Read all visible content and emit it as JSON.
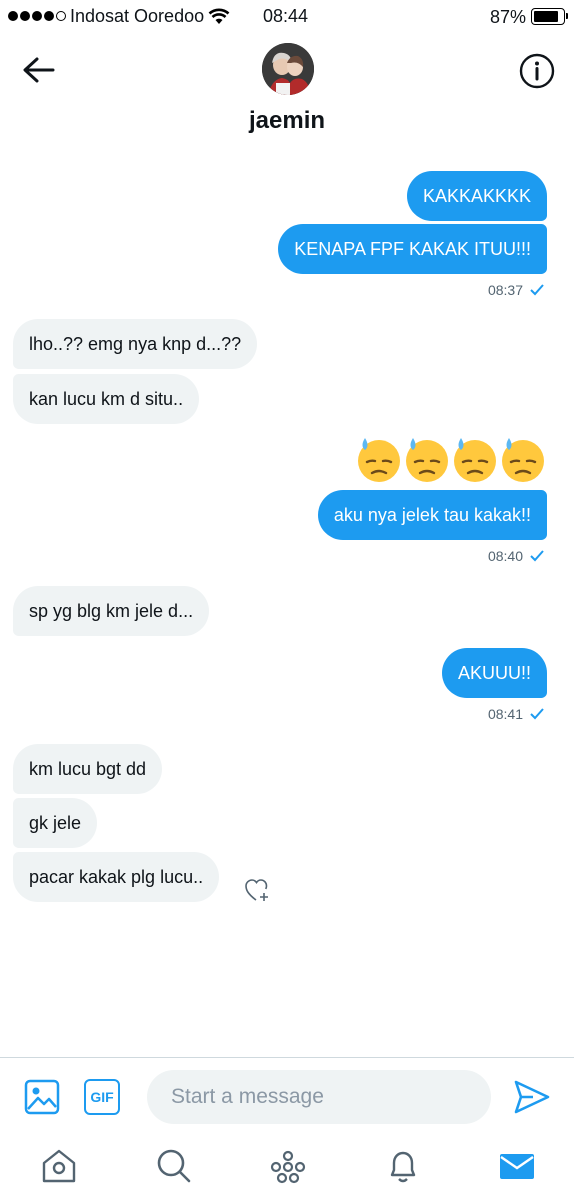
{
  "status_bar": {
    "carrier": "Indosat Ooredoo",
    "time": "08:44",
    "battery_percent": "87%",
    "battery_level": 0.87,
    "signal_bars_filled": 4,
    "signal_bars_total": 5
  },
  "header": {
    "contact_name": "jaemin",
    "back_icon": "arrow-left-icon",
    "info_icon": "info-icon"
  },
  "messages": [
    {
      "direction": "out",
      "text": "KAKKAKKKK"
    },
    {
      "direction": "out",
      "text": "KENAPA FPF KAKAK ITUU!!!"
    },
    {
      "direction": "out-time",
      "text": "08:37"
    },
    {
      "direction": "in",
      "text": "lho..?? emg nya knp d...??"
    },
    {
      "direction": "in",
      "text": "kan lucu km d situ.."
    },
    {
      "direction": "out-emoji",
      "emoji": "downcast-face-with-sweat",
      "count": 4
    },
    {
      "direction": "out",
      "text": "aku nya jelek tau kakak!!"
    },
    {
      "direction": "out-time",
      "text": "08:40"
    },
    {
      "direction": "in",
      "text": "sp yg blg km jele d..."
    },
    {
      "direction": "out",
      "text": "AKUUU!!"
    },
    {
      "direction": "out-time",
      "text": "08:41"
    },
    {
      "direction": "in",
      "text": "km lucu bgt dd"
    },
    {
      "direction": "in",
      "text": "gk jele"
    },
    {
      "direction": "in",
      "text": "pacar kakak plg lucu.."
    }
  ],
  "composer": {
    "placeholder": "Start a message",
    "gif_label": "GIF",
    "media_icon": "image-icon",
    "send_icon": "send-icon"
  },
  "bottom_nav": {
    "items": [
      "home-icon",
      "search-icon",
      "spaces-icon",
      "notifications-icon",
      "messages-icon"
    ],
    "active": "messages-icon"
  },
  "colors": {
    "accent": "#1d9bf0",
    "incoming_bubble": "#eff3f4",
    "text": "#0f1419",
    "muted": "#536471"
  }
}
